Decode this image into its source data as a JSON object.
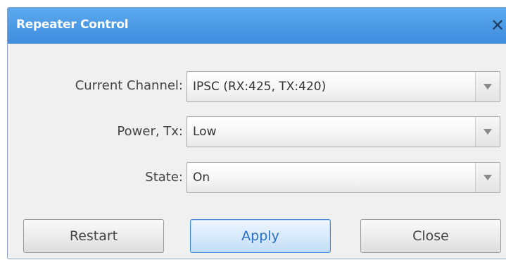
{
  "window": {
    "title": "Repeater Control",
    "close_glyph": "✕"
  },
  "form": {
    "current_channel": {
      "label": "Current Channel:",
      "value": "IPSC (RX:425, TX:420)"
    },
    "power_tx": {
      "label": "Power, Tx:",
      "value": "Low"
    },
    "state": {
      "label": "State:",
      "value": "On"
    }
  },
  "buttons": {
    "restart": "Restart",
    "apply": "Apply",
    "close": "Close"
  },
  "colors": {
    "title_bar": "#4a9be6",
    "title_text": "#ffffff",
    "dialog_background": "#f0f0f0",
    "apply_accent": "#3d8bd8"
  },
  "icons": {
    "close": "close-icon",
    "dropdown": "chevron-down-icon"
  }
}
